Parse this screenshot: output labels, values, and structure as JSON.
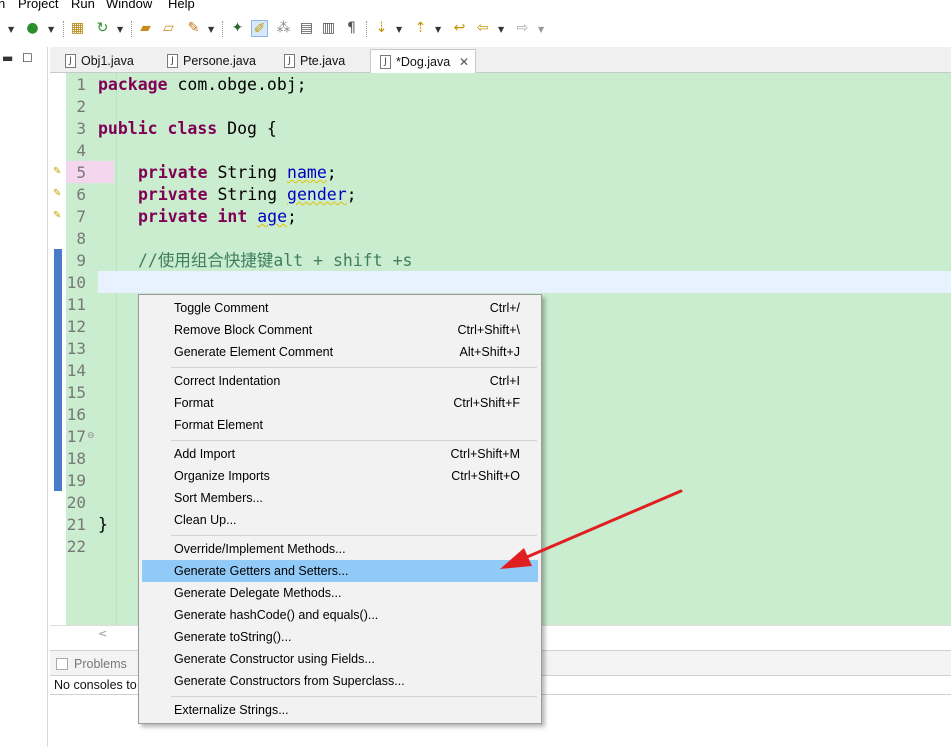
{
  "menubar": {
    "items": [
      "n",
      "Project",
      "Run",
      "Window",
      "Help"
    ]
  },
  "tabs": [
    {
      "label": "Obj1.java",
      "active": false
    },
    {
      "label": "Persone.java",
      "active": false
    },
    {
      "label": "Pte.java",
      "active": false
    },
    {
      "label": "*Dog.java",
      "active": true
    }
  ],
  "editor": {
    "line_numbers": [
      "1",
      "2",
      "3",
      "4",
      "5",
      "6",
      "7",
      "8",
      "9",
      "10",
      "11",
      "12",
      "13",
      "14",
      "15",
      "16",
      "17",
      "18",
      "19",
      "20",
      "21",
      "22"
    ],
    "lines": {
      "l1_kw": "package",
      "l1_rest": " com.obge.obj;",
      "l3_kw": "public class",
      "l3_rest": " Dog {",
      "l5_kw": "private",
      "l5_type": " String ",
      "l5_field": "name",
      "l5_end": ";",
      "l6_kw": "private",
      "l6_type": " String ",
      "l6_field": "gender",
      "l6_end": ";",
      "l7_kw": "private int",
      "l7_field": "age",
      "l7_end": ";",
      "l9_comment": "//使用组合快捷键alt + shift +s",
      "l21": "}"
    }
  },
  "context_menu": {
    "groups": [
      [
        {
          "label": "Toggle Comment",
          "accel": "Ctrl+/"
        },
        {
          "label": "Remove Block Comment",
          "accel": "Ctrl+Shift+\\"
        },
        {
          "label": "Generate Element Comment",
          "accel": "Alt+Shift+J"
        }
      ],
      [
        {
          "label": "Correct Indentation",
          "accel": "Ctrl+I"
        },
        {
          "label": "Format",
          "accel": "Ctrl+Shift+F"
        },
        {
          "label": "Format Element",
          "accel": ""
        }
      ],
      [
        {
          "label": "Add Import",
          "accel": "Ctrl+Shift+M"
        },
        {
          "label": "Organize Imports",
          "accel": "Ctrl+Shift+O"
        },
        {
          "label": "Sort Members...",
          "accel": ""
        },
        {
          "label": "Clean Up...",
          "accel": ""
        }
      ],
      [
        {
          "label": "Override/Implement Methods...",
          "accel": ""
        },
        {
          "label": "Generate Getters and Setters...",
          "accel": "",
          "selected": true
        },
        {
          "label": "Generate Delegate Methods...",
          "accel": ""
        },
        {
          "label": "Generate hashCode() and equals()...",
          "accel": ""
        },
        {
          "label": "Generate toString()...",
          "accel": ""
        },
        {
          "label": "Generate Constructor using Fields...",
          "accel": ""
        },
        {
          "label": "Generate Constructors from Superclass...",
          "accel": ""
        }
      ],
      [
        {
          "label": "Externalize Strings...",
          "accel": ""
        }
      ]
    ]
  },
  "bottom": {
    "problems_tab": "Problems",
    "console_text": "No consoles to"
  },
  "colors": {
    "editor_bg": "#caeccf",
    "selection": "#91c9f7",
    "arrow": "#e02020"
  }
}
